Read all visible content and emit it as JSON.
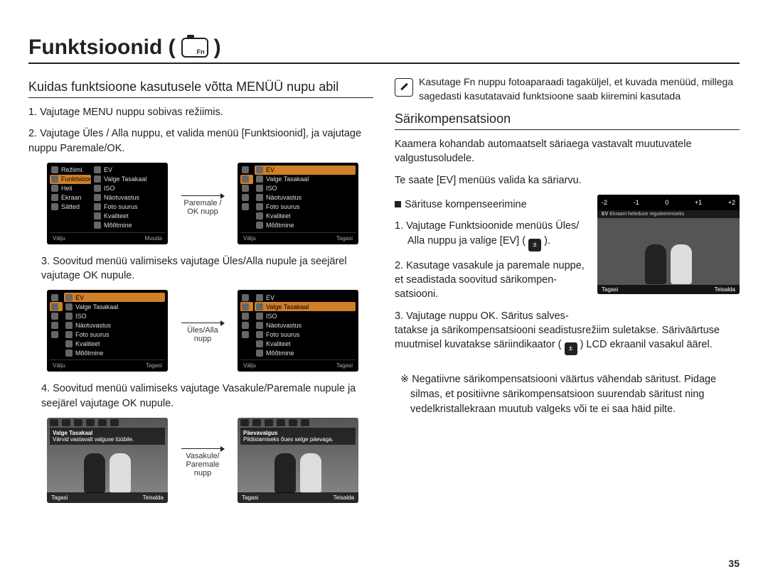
{
  "page_title": "Funktsioonid (",
  "page_title_close": ")",
  "page_number": "35",
  "left": {
    "subhead": "Kuidas funktsioone kasutusele võtta MENÜÜ nupu abil",
    "step1": "1. Vajutage MENU nuppu sobivas režiimis.",
    "step2": "2. Vajutage Üles / Alla nuppu, et valida menüü [Funktsioonid], ja vajutage nuppu Paremale/OK.",
    "arrow1": "Paremale / OK nupp",
    "step3": "3. Soovitud menüü valimiseks vajutage Üles/Alla nupule ja seejärel vajutage OK nupule.",
    "arrow2": "Üles/Alla nupp",
    "step4": "4. Soovitud menüü valimiseks vajutage Vasakule/Paremale nupule ja seejärel vajutage OK nupule.",
    "arrow3": "Vasakule/ Paremale nupp"
  },
  "lcd_menu": {
    "sidebar": [
      "Režiimi.",
      "Funktsioonid",
      "Heli",
      "Ekraan",
      "Sätted"
    ],
    "mainlist": [
      "EV",
      "Valge Tasakaal",
      "ISO",
      "Näotuvastus",
      "Foto suurus",
      "Kvaliteet",
      "Mõõtmine"
    ],
    "foot_left": "Välju",
    "foot_right_muuda": "Muuda",
    "foot_right_tagasi": "Tagasi"
  },
  "photo_lcd": {
    "row1_caption_title": "Valge Tasakaal",
    "row1_caption_sub": "Värvid vastavalt valguse tüübile.",
    "row2_caption_title": "Päevavalgus",
    "row2_caption_sub": "Pildistamiseks õues selge päevaga.",
    "foot_back": "Tagasi",
    "foot_move": "Teisalda"
  },
  "right": {
    "tip": "Kasutage Fn nuppu fotoaparaadi tagaküljel, et kuvada menüüd, millega sagedasti kasutatavaid funktsioone saab kiiremini kasutada",
    "subhead": "Särikompensatsioon",
    "intro1": "Kaamera kohandab automaatselt säriaega vastavalt muutuvatele valgustusoludele.",
    "intro2": "Te saate [EV] menüüs valida ka säriarvu.",
    "bullet_head": "Särituse kompenseerimine",
    "step1a": "1. Vajutage Funktsioonide menüüs Üles/",
    "step1b": "Alla nuppu ja valige [EV] (",
    "step1c": ").",
    "step2": "2. Kasutage vasakule ja paremale nuppe, et seadistada soovitud särikompen- satsiooni.",
    "step3a": "3. Vajutage nuppu OK.  Säritus salves-",
    "step3b": "tatakse ja särikompensatsiooni seadistusrežiim suletakse. Säriväärtuse muutmisel kuvatakse säriindikaator (",
    "step3c": ") LCD ekraanil vasakul äärel.",
    "note": "Negatiivne särikompensatsiooni väärtus vähendab säritust. Pidage silmas, et positiivne särikompensatsioon suurendab säritust ning vedelkristallekraan muutub valgeks või te ei saa häid pilte."
  },
  "ev_lcd": {
    "scale": [
      "-2",
      "-1",
      "0",
      "+1",
      "+2"
    ],
    "label": "EV",
    "sub": "Ekraani heleduse reguleerimiseks",
    "foot_back": "Tagasi",
    "foot_move": "Teisalda"
  }
}
